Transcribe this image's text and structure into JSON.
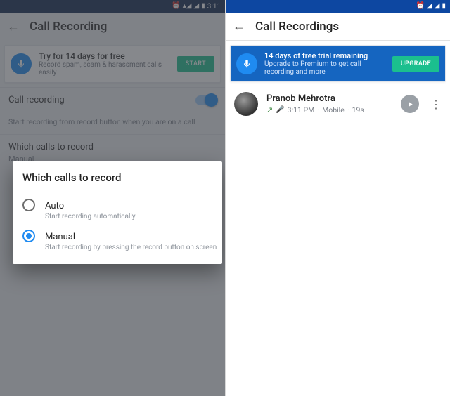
{
  "left": {
    "status_time": "3:11",
    "appbar_title": "Call Recording",
    "promo": {
      "title": "Try for 14 days for free",
      "subtitle": "Record spam, scam & harassment calls easily",
      "cta": "START"
    },
    "rows": {
      "recording": {
        "label": "Call recording",
        "sub": "Start recording from record button when you are on a call"
      },
      "which": {
        "label": "Which calls to record",
        "value": "Manual"
      }
    },
    "dialog": {
      "title": "Which calls to record",
      "auto": {
        "label": "Auto",
        "sub": "Start recording automatically"
      },
      "manual": {
        "label": "Manual",
        "sub": "Start recording by pressing the record button on screen"
      }
    }
  },
  "right": {
    "appbar_title": "Call Recordings",
    "promo": {
      "title": "14 days of free trial remaining",
      "subtitle": "Upgrade to Premium to get call recording and more",
      "cta": "UPGRADE"
    },
    "item": {
      "name": "Pranob Mehrotra",
      "time": "3:11 PM",
      "type": "Mobile",
      "duration": "19s"
    }
  }
}
